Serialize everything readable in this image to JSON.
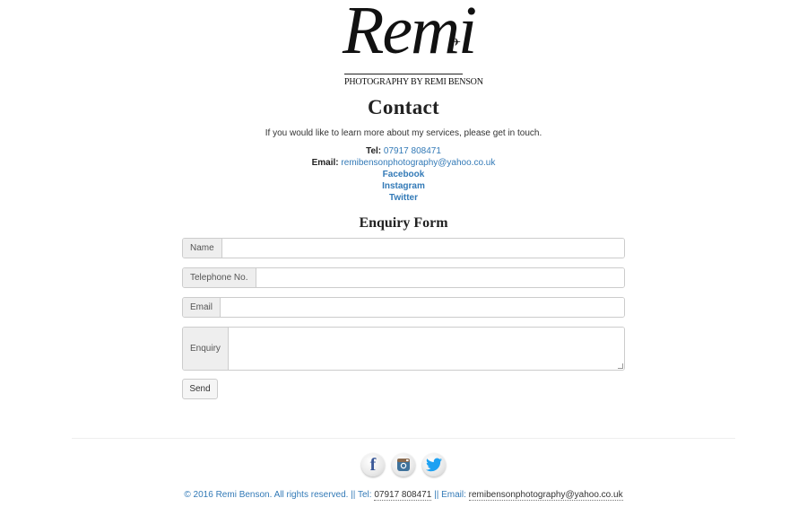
{
  "logo": {
    "word": "Remi",
    "subtitle": "PHOTOGRAPHY BY REMI BENSON"
  },
  "page": {
    "title": "Contact",
    "intro": "If you would like to learn more about my services, please get in touch."
  },
  "contact": {
    "tel_label": "Tel:",
    "tel_value": "07917 808471",
    "email_label": "Email:",
    "email_value": "remibensonphotography@yahoo.co.uk",
    "facebook": "Facebook",
    "instagram": "Instagram",
    "twitter": "Twitter"
  },
  "form": {
    "title": "Enquiry Form",
    "name_label": "Name",
    "name_value": "",
    "telephone_label": "Telephone No.",
    "telephone_value": "",
    "email_label": "Email",
    "email_value": "",
    "enquiry_label": "Enquiry",
    "enquiry_value": "",
    "send_label": "Send"
  },
  "social_icons": [
    "facebook-icon",
    "instagram-icon",
    "twitter-icon"
  ],
  "footer": {
    "copyright": "© 2016 Remi Benson. All rights reserved. || Tel:",
    "tel": "07917 808471",
    "email_prefix": "|| Email:",
    "email": "remibensonphotography@yahoo.co.uk"
  },
  "colors": {
    "link": "#337ab7",
    "facebook": "#3b5998",
    "twitter": "#1da1f2",
    "instagram": "#3f729b"
  }
}
